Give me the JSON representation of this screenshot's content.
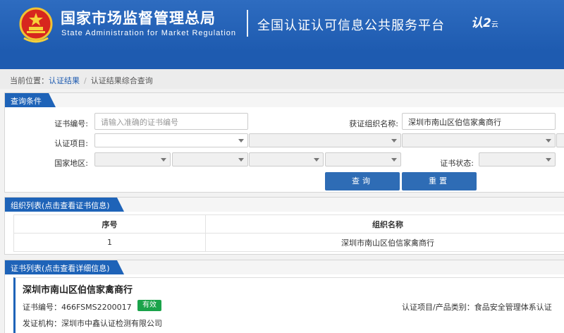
{
  "header": {
    "title_cn": "国家市场监督管理总局",
    "title_en": "State Administration  for  Market Regulation",
    "platform": "全国认证认可信息公共服务平台",
    "logo_main": "认",
    "logo_sub": "云",
    "logo_mid": "2"
  },
  "breadcrumb": {
    "prefix": "当前位置：",
    "items": [
      "认证结果",
      "认证结果综合查询"
    ]
  },
  "query": {
    "section_title": "查询条件",
    "cert_no_label": "证书编号:",
    "cert_no_placeholder": "请输入准确的证书编号",
    "org_name_label": "获证组织名称:",
    "org_name_value": "深圳市南山区伯信家禽商行",
    "project_label": "认证项目:",
    "region_label": "国家地区:",
    "status_label": "证书状态:",
    "search_button": "查询",
    "reset_button": "重置"
  },
  "org_list": {
    "section_title": "组织列表(点击查看证书信息)",
    "columns": [
      "序号",
      "组织名称"
    ],
    "rows": [
      [
        "1",
        "深圳市南山区伯信家禽商行"
      ]
    ]
  },
  "cert_list": {
    "section_title": "证书列表(点击查看详细信息)",
    "org_name": "深圳市南山区伯信家禽商行",
    "cert_no_text": "证书编号：466FSMS2200017",
    "status_badge": "有效",
    "category_text": "认证项目/产品类别：食品安全管理体系认证",
    "issuer_text": "发证机构：深圳市中鑫认证检测有限公司"
  },
  "colors": {
    "header_blue": "#1e5bb0",
    "button_blue": "#2e6cb5",
    "badge_green": "#1aa34a"
  }
}
